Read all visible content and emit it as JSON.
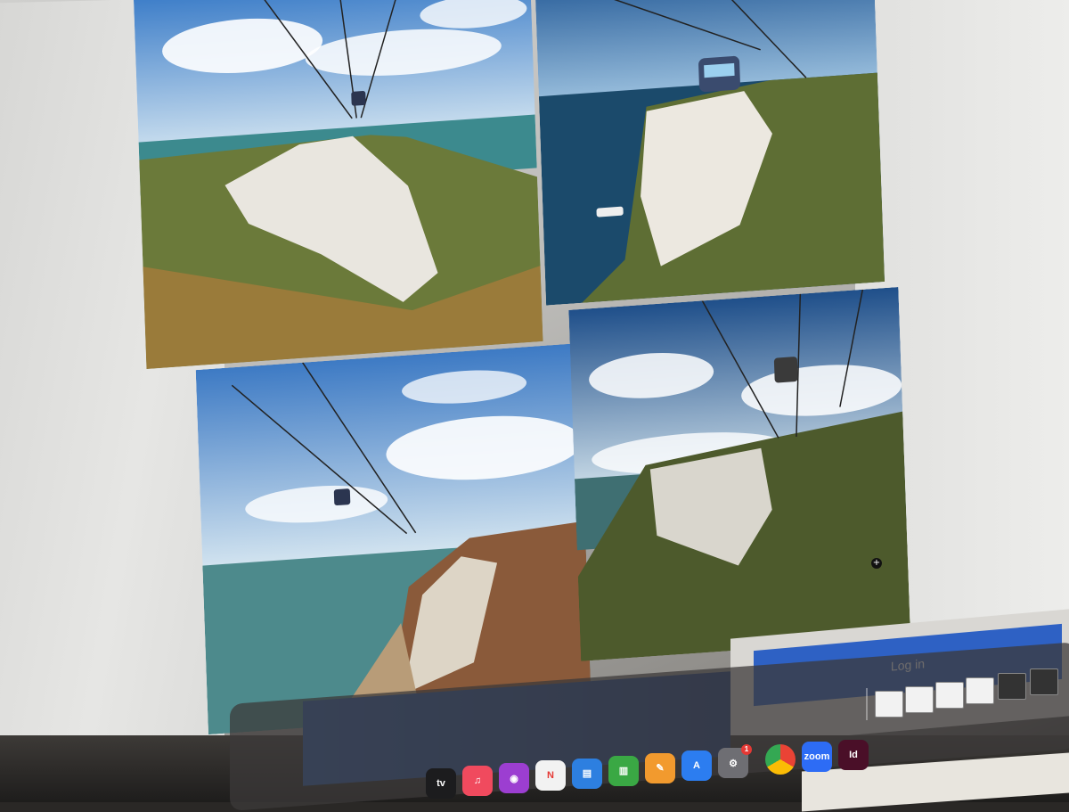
{
  "login": {
    "label": "Log in"
  },
  "dock": {
    "apps": [
      {
        "name": "tv",
        "label": "tv",
        "color": "#1c1c1e"
      },
      {
        "name": "music",
        "label": "♫",
        "color": "#f04a5e"
      },
      {
        "name": "podcasts",
        "label": "◉",
        "color": "#9c3ed1"
      },
      {
        "name": "news",
        "label": "N",
        "color": "#f2f2f2"
      },
      {
        "name": "keynote",
        "label": "▤",
        "color": "#2d7fe0"
      },
      {
        "name": "numbers",
        "label": "▥",
        "color": "#3aa844"
      },
      {
        "name": "pages",
        "label": "✎",
        "color": "#f29a2e"
      },
      {
        "name": "app-store",
        "label": "A",
        "color": "#2c7df0"
      },
      {
        "name": "system-settings",
        "label": "⚙",
        "color": "#6e6e73",
        "badge": "1"
      },
      {
        "name": "chrome",
        "label": "",
        "color": "#ffffff"
      },
      {
        "name": "zoom",
        "label": "zoom",
        "color": "#2d6cf5"
      },
      {
        "name": "indesign",
        "label": "Id",
        "color": "#4a0f28"
      }
    ],
    "left_badge": "1"
  }
}
